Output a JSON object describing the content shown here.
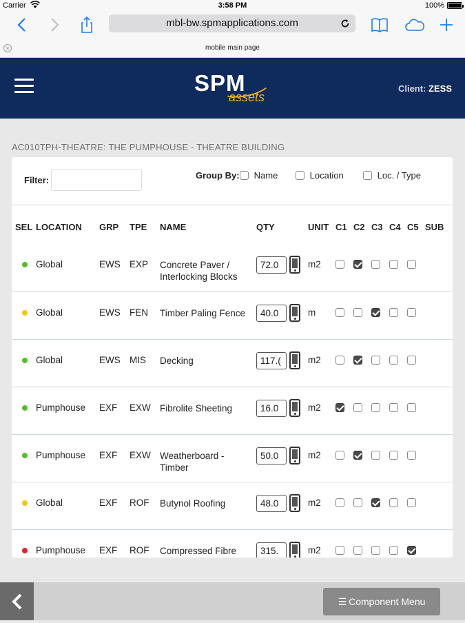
{
  "status_bar": {
    "carrier": "Carrier",
    "time": "3:58 PM",
    "battery": "100%"
  },
  "browser": {
    "url": "mbl-bw.spmapplications.com",
    "tab_title": "mobile main page"
  },
  "header": {
    "logo_main": "SPM",
    "logo_sub": "assets",
    "client_label": "Client:",
    "client_name": "ZESS",
    "brand_color": "#0f2a5c",
    "accent_color": "#f2b21c"
  },
  "page": {
    "building_title": "AC010TPH-THEATRE: THE PUMPHOUSE - THEATRE BUILDING"
  },
  "filter": {
    "label": "Filter:",
    "value": "",
    "group_by_label": "Group By:",
    "group_by_options": [
      {
        "label": "Name",
        "checked": false
      },
      {
        "label": "Location",
        "checked": false
      },
      {
        "label": "Loc. / Type",
        "checked": false
      }
    ]
  },
  "table": {
    "columns": [
      "SEL",
      "LOCATION",
      "GRP",
      "TPE",
      "NAME",
      "QTY",
      "UNIT",
      "C1",
      "C2",
      "C3",
      "C4",
      "C5",
      "SUB"
    ],
    "rows": [
      {
        "status": "green",
        "location": "Global",
        "grp": "EWS",
        "tpe": "EXP",
        "name": "Concrete Paver / Interlocking Blocks",
        "qty": "72.0",
        "unit": "m2",
        "cond": 2
      },
      {
        "status": "yellow",
        "location": "Global",
        "grp": "EWS",
        "tpe": "FEN",
        "name": "Timber Paling Fence",
        "qty": "40.0",
        "unit": "m",
        "cond": 3
      },
      {
        "status": "green",
        "location": "Global",
        "grp": "EWS",
        "tpe": "MIS",
        "name": "Decking",
        "qty": "117.(",
        "unit": "m2",
        "cond": 2
      },
      {
        "status": "green",
        "location": "Pumphouse",
        "grp": "EXF",
        "tpe": "EXW",
        "name": "Fibrolite Sheeting",
        "qty": "16.0",
        "unit": "m2",
        "cond": 1
      },
      {
        "status": "green",
        "location": "Pumphouse",
        "grp": "EXF",
        "tpe": "EXW",
        "name": "Weatherboard - Timber",
        "qty": "50.0",
        "unit": "m2",
        "cond": 2
      },
      {
        "status": "yellow",
        "location": "Global",
        "grp": "EXF",
        "tpe": "ROF",
        "name": "Butynol Roofing",
        "qty": "48.0",
        "unit": "m2",
        "cond": 3
      },
      {
        "status": "red",
        "location": "Pumphouse",
        "grp": "EXF",
        "tpe": "ROF",
        "name": "Compressed Fibre",
        "qty": "315.",
        "unit": "m2",
        "cond": 5
      }
    ],
    "status_colors": {
      "green": "#5cb82e",
      "yellow": "#f0c419",
      "red": "#e0202a"
    }
  },
  "footer": {
    "component_menu_label": "Component Menu"
  }
}
